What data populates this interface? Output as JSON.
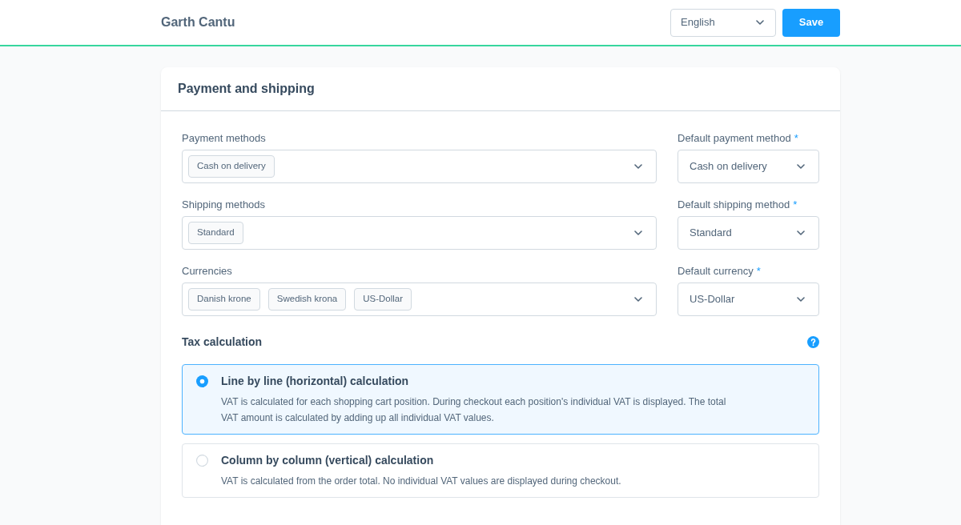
{
  "header": {
    "title": "Garth Cantu",
    "language_select": {
      "value": "English"
    },
    "save_button": "Save"
  },
  "card": {
    "title": "Payment and shipping",
    "rows": [
      {
        "multi": {
          "label": "Payment methods",
          "chips": [
            "Cash on delivery"
          ]
        },
        "default": {
          "label": "Default payment method",
          "required_mark": "*",
          "value": "Cash on delivery"
        }
      },
      {
        "multi": {
          "label": "Shipping methods",
          "chips": [
            "Standard"
          ]
        },
        "default": {
          "label": "Default shipping method",
          "required_mark": "*",
          "value": "Standard"
        }
      },
      {
        "multi": {
          "label": "Currencies",
          "chips": [
            "Danish krone",
            "Swedish krona",
            "US-Dollar"
          ]
        },
        "default": {
          "label": "Default currency",
          "required_mark": "*",
          "value": "US-Dollar"
        }
      }
    ],
    "tax_calculation": {
      "title": "Tax calculation",
      "options": [
        {
          "title": "Line by line (horizontal) calculation",
          "description": "VAT is calculated for each shopping cart position. During checkout each position's individual VAT is displayed. The total VAT amount is calculated by adding up all individual VAT values.",
          "selected": true
        },
        {
          "title": "Column by column (vertical) calculation",
          "description": "VAT is calculated from the order total. No individual VAT values are displayed during checkout.",
          "selected": false
        }
      ]
    }
  }
}
